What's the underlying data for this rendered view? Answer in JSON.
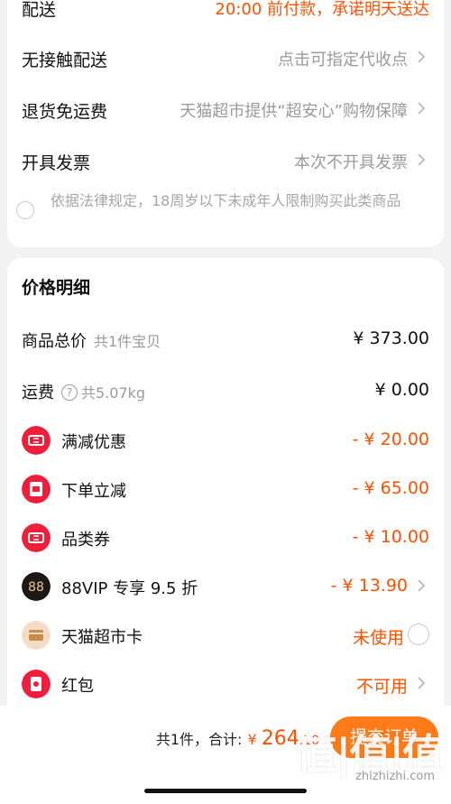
{
  "delivery": {
    "top_label": "配送",
    "top_value": "20:00 前付款，承诺明天送达",
    "rows": [
      {
        "label": "无接触配送",
        "value": "点击可指定代收点"
      },
      {
        "label": "退货免运费",
        "value": "天猫超市提供“超安心”购物保障"
      },
      {
        "label": "开具发票",
        "value": "本次不开具发票"
      }
    ],
    "notice": "依据法律规定，18周岁以下未成年人限制购买此类商品"
  },
  "price": {
    "title": "价格明细",
    "goods_total_label": "商品总价",
    "goods_total_sub": "共1件宝贝",
    "goods_total_value": "¥ 373.00",
    "shipping_label": "运费",
    "shipping_help_icon": "?",
    "shipping_sub": "共5.07kg",
    "shipping_value": "¥ 0.00",
    "discounts": [
      {
        "label": "满减优惠",
        "value": "- ¥ 20.00",
        "icon": "ticket-icon"
      },
      {
        "label": "下单立减",
        "value": "- ¥ 65.00",
        "icon": "instant-discount-icon"
      },
      {
        "label": "品类券",
        "value": "- ¥ 10.00",
        "icon": "ticket-icon"
      },
      {
        "label": "88VIP 专享 9.5 折",
        "value": "- ¥ 13.90",
        "icon": "88vip-icon"
      },
      {
        "label": "天猫超市卡",
        "value": "未使用",
        "icon": "card-icon"
      },
      {
        "label": "红包",
        "value": "不可用",
        "icon": "red-packet-icon"
      }
    ]
  },
  "footer": {
    "count_text": "共1件，",
    "total_label": "合计:",
    "currency": "¥",
    "total_int": "264",
    "total_dec": ".10",
    "submit_label": "提交订单"
  },
  "watermark": {
    "main": "值|值|值",
    "sub": "zhizhizhi.com"
  },
  "colors": {
    "accent": "#ff5000",
    "submit": "#ff7a18",
    "icon_red": "#ee1f3a"
  }
}
